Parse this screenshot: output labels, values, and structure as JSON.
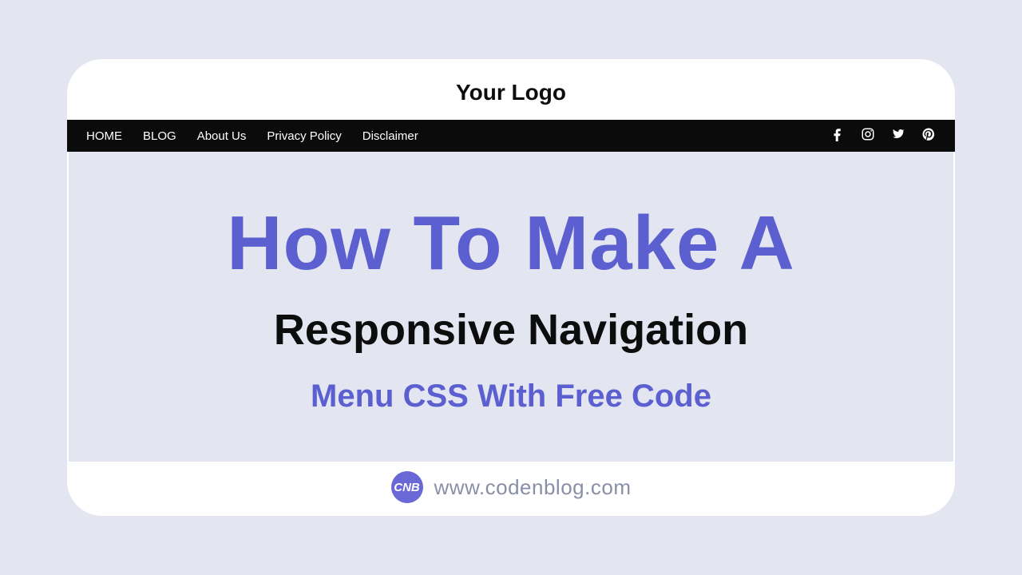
{
  "logoText": "Your Logo",
  "nav": {
    "links": [
      "HOME",
      "BLOG",
      "About Us",
      "Privacy Policy",
      "Disclaimer"
    ],
    "social": [
      "facebook",
      "instagram",
      "twitter",
      "pinterest"
    ]
  },
  "heading": {
    "line1": "How To Make A",
    "line2": "Responsive Navigation",
    "line3": "Menu CSS With Free Code"
  },
  "brand": {
    "badge": "CNB",
    "url": "www.codenblog.com"
  }
}
